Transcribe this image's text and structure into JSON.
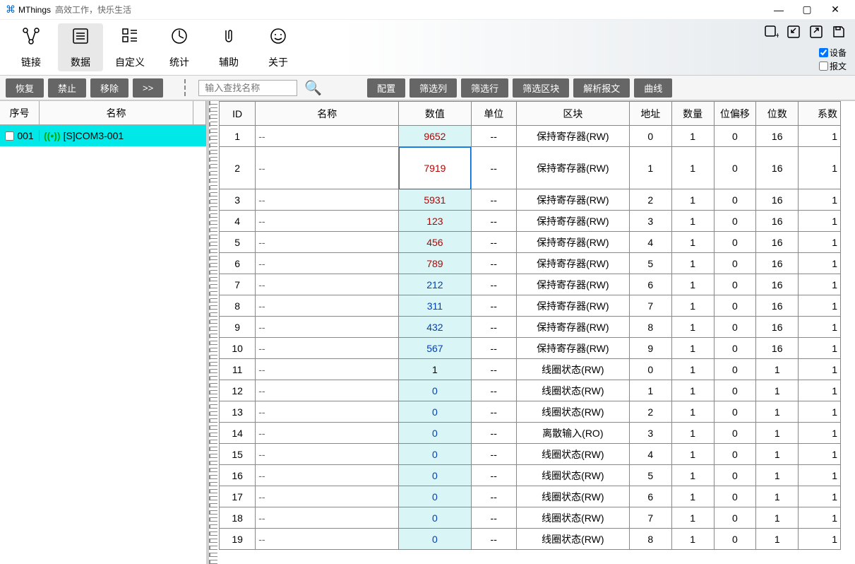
{
  "title": {
    "app": "MThings",
    "subtitle": "高效工作，快乐生活"
  },
  "win": {
    "min": "—",
    "max": "▢",
    "close": "✕"
  },
  "toolbar": [
    {
      "icon": "connect",
      "label": "链接"
    },
    {
      "icon": "data",
      "label": "数据",
      "active": true
    },
    {
      "icon": "custom",
      "label": "自定义"
    },
    {
      "icon": "stats",
      "label": "统计"
    },
    {
      "icon": "assist",
      "label": "辅助"
    },
    {
      "icon": "about",
      "label": "关于"
    }
  ],
  "toolbar_right": {
    "icons": [
      "add-panel",
      "import",
      "export",
      "save"
    ],
    "checks": [
      {
        "label": "设备",
        "checked": true
      },
      {
        "label": "报文",
        "checked": false
      }
    ]
  },
  "left_controls": [
    "恢复",
    "禁止",
    "移除",
    ">>"
  ],
  "search": {
    "placeholder": "输入查找名称"
  },
  "right_controls": [
    "配置",
    "筛选列",
    "筛选行",
    "筛选区块",
    "解析报文",
    "曲线"
  ],
  "left_table": {
    "headers": {
      "sn": "序号",
      "name": "名称"
    },
    "rows": [
      {
        "sn": "001",
        "name": "[S]COM3-001"
      }
    ]
  },
  "main_table": {
    "headers": [
      "ID",
      "名称",
      "数值",
      "单位",
      "区块",
      "地址",
      "数量",
      "位偏移",
      "位数",
      "系数"
    ],
    "rows": [
      {
        "id": 1,
        "name": "--",
        "val": "9652",
        "cls": "red",
        "unit": "--",
        "block": "保持寄存器(RW)",
        "addr": 0,
        "cnt": 1,
        "off": 0,
        "bits": 16,
        "coef": 1
      },
      {
        "id": 2,
        "name": "--",
        "val": "7919",
        "cls": "red",
        "unit": "--",
        "block": "保持寄存器(RW)",
        "addr": 1,
        "cnt": 1,
        "off": 0,
        "bits": 16,
        "coef": 1,
        "sel": true
      },
      {
        "id": 3,
        "name": "--",
        "val": "5931",
        "cls": "red",
        "unit": "--",
        "block": "保持寄存器(RW)",
        "addr": 2,
        "cnt": 1,
        "off": 0,
        "bits": 16,
        "coef": 1
      },
      {
        "id": 4,
        "name": "--",
        "val": "123",
        "cls": "red",
        "unit": "--",
        "block": "保持寄存器(RW)",
        "addr": 3,
        "cnt": 1,
        "off": 0,
        "bits": 16,
        "coef": 1
      },
      {
        "id": 5,
        "name": "--",
        "val": "456",
        "cls": "red",
        "unit": "--",
        "block": "保持寄存器(RW)",
        "addr": 4,
        "cnt": 1,
        "off": 0,
        "bits": 16,
        "coef": 1
      },
      {
        "id": 6,
        "name": "--",
        "val": "789",
        "cls": "red",
        "unit": "--",
        "block": "保持寄存器(RW)",
        "addr": 5,
        "cnt": 1,
        "off": 0,
        "bits": 16,
        "coef": 1
      },
      {
        "id": 7,
        "name": "--",
        "val": "212",
        "cls": "blue",
        "unit": "--",
        "block": "保持寄存器(RW)",
        "addr": 6,
        "cnt": 1,
        "off": 0,
        "bits": 16,
        "coef": 1
      },
      {
        "id": 8,
        "name": "--",
        "val": "311",
        "cls": "blue",
        "unit": "--",
        "block": "保持寄存器(RW)",
        "addr": 7,
        "cnt": 1,
        "off": 0,
        "bits": 16,
        "coef": 1
      },
      {
        "id": 9,
        "name": "--",
        "val": "432",
        "cls": "blue",
        "unit": "--",
        "block": "保持寄存器(RW)",
        "addr": 8,
        "cnt": 1,
        "off": 0,
        "bits": 16,
        "coef": 1
      },
      {
        "id": 10,
        "name": "--",
        "val": "567",
        "cls": "blue",
        "unit": "--",
        "block": "保持寄存器(RW)",
        "addr": 9,
        "cnt": 1,
        "off": 0,
        "bits": 16,
        "coef": 1
      },
      {
        "id": 11,
        "name": "--",
        "val": "1",
        "cls": "black",
        "unit": "--",
        "block": "线圈状态(RW)",
        "addr": 0,
        "cnt": 1,
        "off": 0,
        "bits": 1,
        "coef": 1
      },
      {
        "id": 12,
        "name": "--",
        "val": "0",
        "cls": "blue",
        "unit": "--",
        "block": "线圈状态(RW)",
        "addr": 1,
        "cnt": 1,
        "off": 0,
        "bits": 1,
        "coef": 1
      },
      {
        "id": 13,
        "name": "--",
        "val": "0",
        "cls": "blue",
        "unit": "--",
        "block": "线圈状态(RW)",
        "addr": 2,
        "cnt": 1,
        "off": 0,
        "bits": 1,
        "coef": 1
      },
      {
        "id": 14,
        "name": "--",
        "val": "0",
        "cls": "blue",
        "unit": "--",
        "block": "离散输入(RO)",
        "addr": 3,
        "cnt": 1,
        "off": 0,
        "bits": 1,
        "coef": 1
      },
      {
        "id": 15,
        "name": "--",
        "val": "0",
        "cls": "blue",
        "unit": "--",
        "block": "线圈状态(RW)",
        "addr": 4,
        "cnt": 1,
        "off": 0,
        "bits": 1,
        "coef": 1
      },
      {
        "id": 16,
        "name": "--",
        "val": "0",
        "cls": "blue",
        "unit": "--",
        "block": "线圈状态(RW)",
        "addr": 5,
        "cnt": 1,
        "off": 0,
        "bits": 1,
        "coef": 1
      },
      {
        "id": 17,
        "name": "--",
        "val": "0",
        "cls": "blue",
        "unit": "--",
        "block": "线圈状态(RW)",
        "addr": 6,
        "cnt": 1,
        "off": 0,
        "bits": 1,
        "coef": 1
      },
      {
        "id": 18,
        "name": "--",
        "val": "0",
        "cls": "blue",
        "unit": "--",
        "block": "线圈状态(RW)",
        "addr": 7,
        "cnt": 1,
        "off": 0,
        "bits": 1,
        "coef": 1
      },
      {
        "id": 19,
        "name": "--",
        "val": "0",
        "cls": "blue",
        "unit": "--",
        "block": "线圈状态(RW)",
        "addr": 8,
        "cnt": 1,
        "off": 0,
        "bits": 1,
        "coef": 1
      }
    ]
  }
}
